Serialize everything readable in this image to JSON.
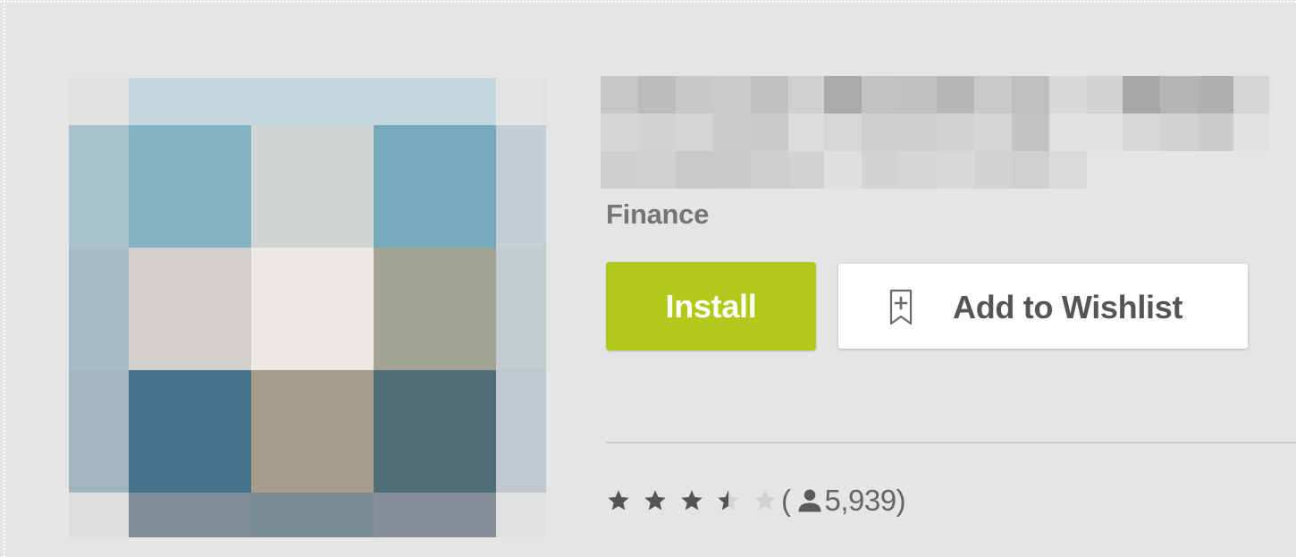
{
  "app": {
    "category": "Finance",
    "install_label": "Install",
    "wishlist_label": "Add to Wishlist",
    "rating": {
      "stars_filled": 3.5,
      "stars_total": 5,
      "open_paren": "(",
      "count": "5,939",
      "close_paren": ")"
    }
  },
  "icons": {
    "wishlist": "bookmark-plus-icon",
    "reviewers": "person-icon",
    "star": "star-icon"
  },
  "colors": {
    "install_button": "#b0c91b",
    "background": "#e5e5e5",
    "category_text": "#757575",
    "star_filled": "#555555",
    "star_empty": "#d2d2d2"
  }
}
